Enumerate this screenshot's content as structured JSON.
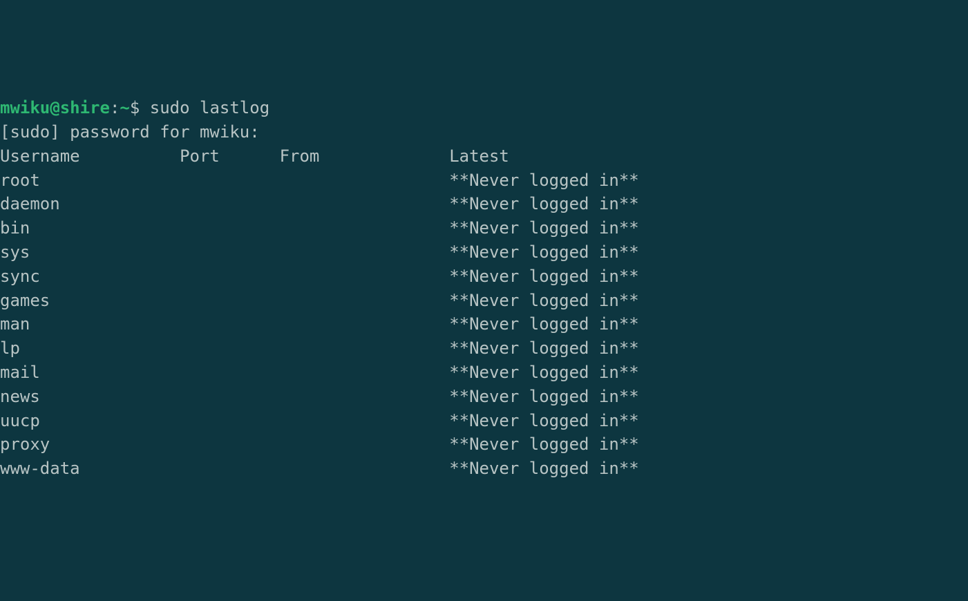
{
  "prompt": {
    "user": "mwiku",
    "host": "shire",
    "path": "~",
    "symbol": "$"
  },
  "command": "sudo lastlog",
  "sudo_prompt": "[sudo] password for mwiku:",
  "headers": {
    "username": "Username",
    "port": "Port",
    "from": "From",
    "latest": "Latest"
  },
  "rows": [
    {
      "username": "root",
      "port": "",
      "from": "",
      "latest": "**Never logged in**"
    },
    {
      "username": "daemon",
      "port": "",
      "from": "",
      "latest": "**Never logged in**"
    },
    {
      "username": "bin",
      "port": "",
      "from": "",
      "latest": "**Never logged in**"
    },
    {
      "username": "sys",
      "port": "",
      "from": "",
      "latest": "**Never logged in**"
    },
    {
      "username": "sync",
      "port": "",
      "from": "",
      "latest": "**Never logged in**"
    },
    {
      "username": "games",
      "port": "",
      "from": "",
      "latest": "**Never logged in**"
    },
    {
      "username": "man",
      "port": "",
      "from": "",
      "latest": "**Never logged in**"
    },
    {
      "username": "lp",
      "port": "",
      "from": "",
      "latest": "**Never logged in**"
    },
    {
      "username": "mail",
      "port": "",
      "from": "",
      "latest": "**Never logged in**"
    },
    {
      "username": "news",
      "port": "",
      "from": "",
      "latest": "**Never logged in**"
    },
    {
      "username": "uucp",
      "port": "",
      "from": "",
      "latest": "**Never logged in**"
    },
    {
      "username": "proxy",
      "port": "",
      "from": "",
      "latest": "**Never logged in**"
    },
    {
      "username": "www-data",
      "port": "",
      "from": "",
      "latest": "**Never logged in**"
    }
  ]
}
